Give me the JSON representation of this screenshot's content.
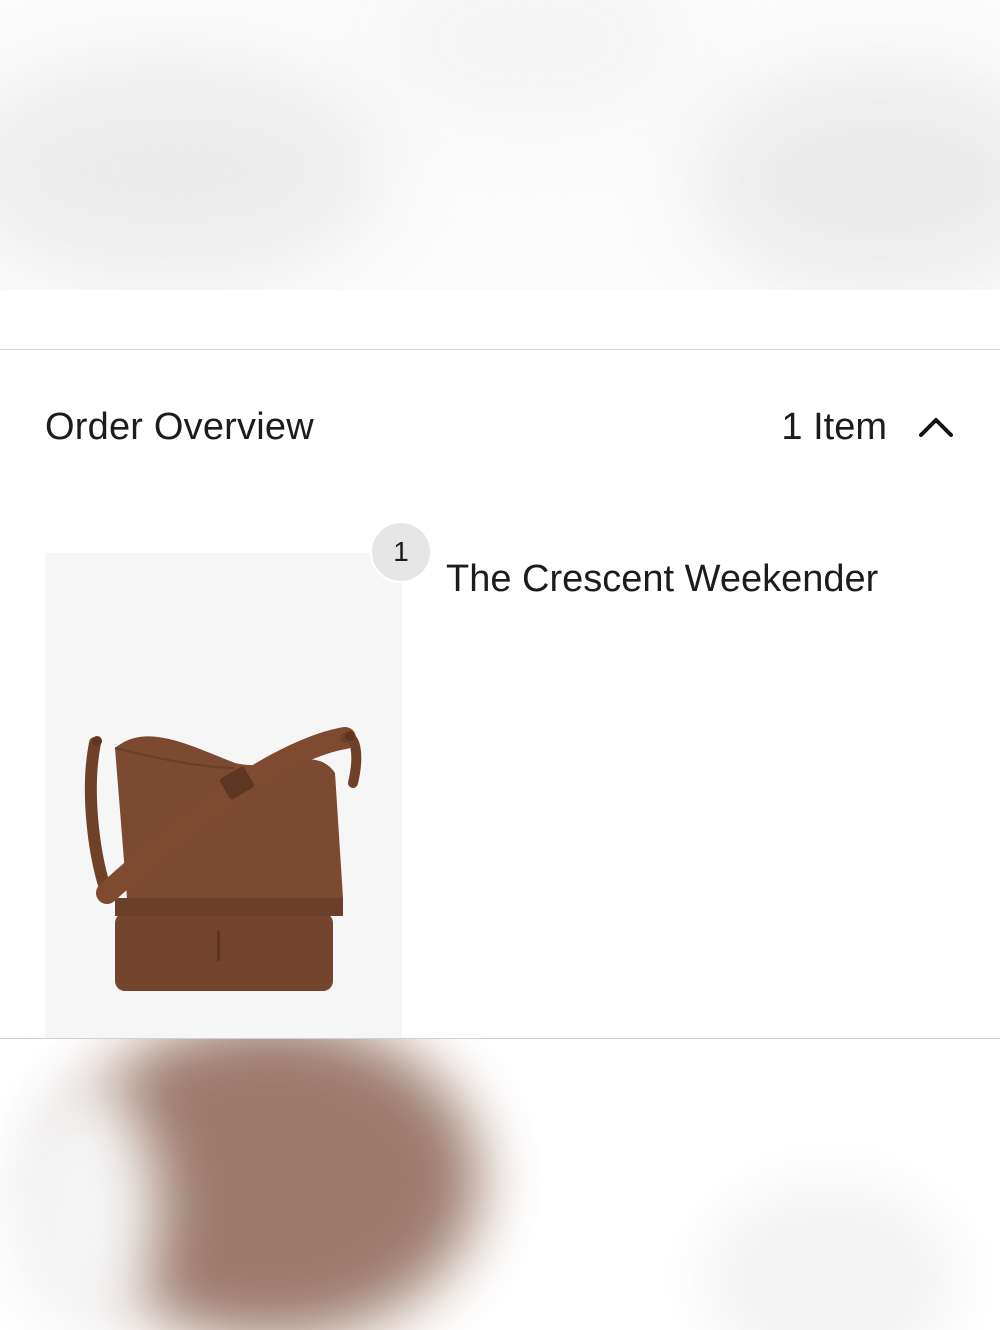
{
  "order_overview": {
    "title": "Order Overview",
    "item_count": "1 Item",
    "toggle_icon": "chevron-up-icon"
  },
  "product": {
    "quantity": "1",
    "name": "The Crescent Weekender",
    "image": "brown-crescent-weekender-bag"
  },
  "colors": {
    "bag_brown": "#7a4a32",
    "thumb_bg": "#f6f6f6",
    "badge_bg": "#e6e6e6",
    "divider": "#d9d9d9"
  }
}
